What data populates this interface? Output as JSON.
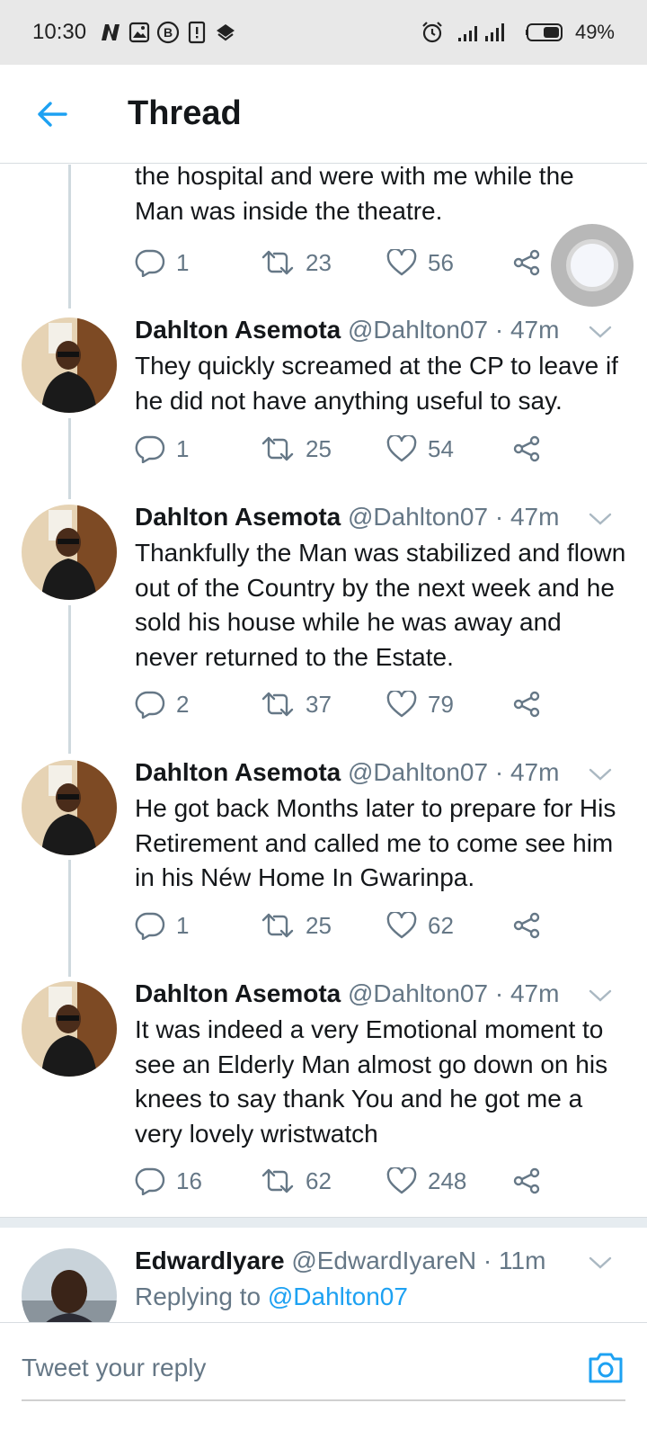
{
  "status_bar": {
    "time": "10:30",
    "battery": "49%"
  },
  "header": {
    "title": "Thread",
    "accent": "#1da1f2"
  },
  "tweets": [
    {
      "text": "the hospital and were with me while the Man was inside the theatre.",
      "replies": "1",
      "retweets": "23",
      "likes": "56"
    },
    {
      "name": "Dahlton Asemota",
      "handle": "@Dahlton07 · 47m",
      "text": "They quickly screamed at the CP to leave if he did not have anything useful to say.",
      "replies": "1",
      "retweets": "25",
      "likes": "54"
    },
    {
      "name": "Dahlton Asemota",
      "handle": "@Dahlton07 · 47m",
      "text": "Thankfully the Man was stabilized and flown out of the Country by the next week and he sold his house while he was away and never returned to the Estate.",
      "replies": "2",
      "retweets": "37",
      "likes": "79"
    },
    {
      "name": "Dahlton Asemota",
      "handle": "@Dahlton07 · 47m",
      "text": "He got back Months later to prepare for His Retirement and called me to come see him in his Néw Home In Gwarinpa.",
      "replies": "1",
      "retweets": "25",
      "likes": "62"
    },
    {
      "name": "Dahlton Asemota",
      "handle": "@Dahlton07 · 47m",
      "text": "It was indeed a very Emotional moment to see an Elderly Man almost go down on his knees to say thank You and he got me a very lovely wristwatch",
      "replies": "16",
      "retweets": "62",
      "likes": "248"
    }
  ],
  "reply_tweet": {
    "name": "EdwardIyare",
    "handle": "@EdwardIyareN · 11m",
    "replying_prefix": "Replying to",
    "replying_to": "@Dahlton07"
  },
  "reply_bar": {
    "placeholder": "Tweet your reply"
  }
}
